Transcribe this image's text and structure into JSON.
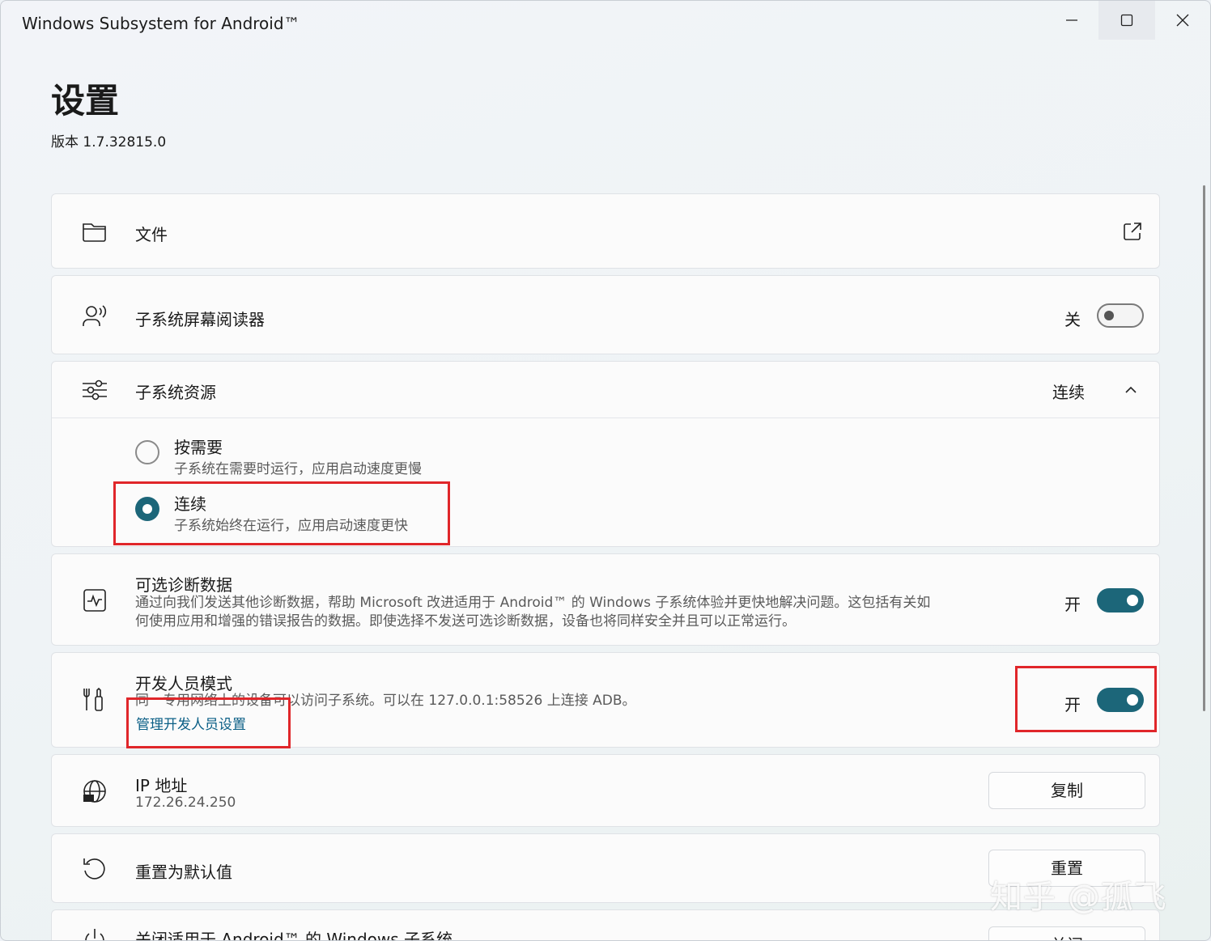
{
  "window": {
    "title": "Windows Subsystem for Android™"
  },
  "header": {
    "title": "设置",
    "version": "版本 1.7.32815.0"
  },
  "files": {
    "label": "文件"
  },
  "screen_reader": {
    "label": "子系统屏幕阅读器",
    "state": "关",
    "toggle_on": false
  },
  "resources": {
    "label": "子系统资源",
    "value": "连续",
    "options": [
      {
        "title": "按需要",
        "desc": "子系统在需要时运行，应用启动速度更慢",
        "selected": false
      },
      {
        "title": "连续",
        "desc": "子系统始终在运行，应用启动速度更快",
        "selected": true
      }
    ]
  },
  "diagnostics": {
    "label": "可选诊断数据",
    "desc_line1": "通过向我们发送其他诊断数据，帮助 Microsoft 改进适用于 Android™ 的 Windows 子系统体验并更快地解决问题。这包括有关如",
    "desc_line2": "何使用应用和增强的错误报告的数据。即使选择不发送可选诊断数据，设备也将同样安全并且可以正常运行。",
    "state": "开",
    "toggle_on": true
  },
  "developer": {
    "label": "开发人员模式",
    "desc": "同一专用网络上的设备可以访问子系统。可以在 127.0.0.1:58526 上连接 ADB。",
    "link": "管理开发人员设置",
    "state": "开",
    "toggle_on": true
  },
  "ip": {
    "label": "IP 地址",
    "value": "172.26.24.250",
    "button": "复制"
  },
  "reset": {
    "label": "重置为默认值",
    "button": "重置"
  },
  "shutdown": {
    "label": "关闭适用于 Android™ 的 Windows 子系统",
    "button": "关闭"
  },
  "watermark": "知乎 @孤飞",
  "colors": {
    "accent": "#1c6679",
    "highlight": "#e0262a",
    "link": "#0b5f86"
  }
}
